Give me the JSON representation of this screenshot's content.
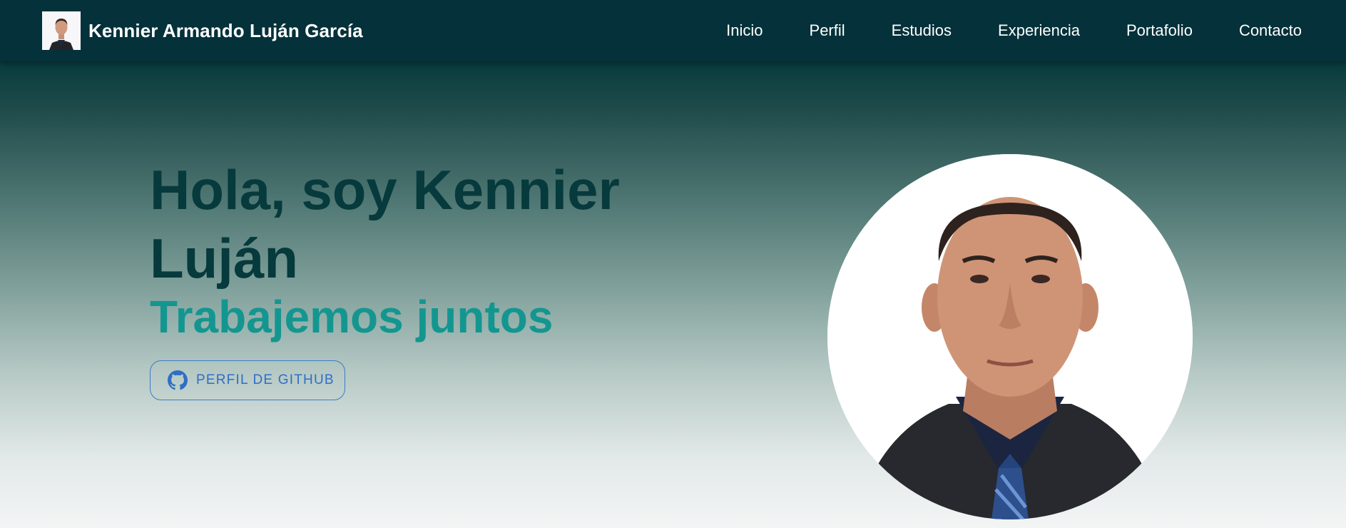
{
  "header": {
    "brand_name": "Kennier Armando Luján García",
    "avatar_icon": "profile-photo-thumbnail",
    "nav_items": [
      {
        "label": "Inicio"
      },
      {
        "label": "Perfil"
      },
      {
        "label": "Estudios"
      },
      {
        "label": "Experiencia"
      },
      {
        "label": "Portafolio"
      },
      {
        "label": "Contacto"
      }
    ]
  },
  "hero": {
    "title": "Hola, soy Kennier Luján",
    "subtitle": "Trabajemos juntos",
    "github_button": {
      "label": "Perfil de GitHub",
      "icon": "github-icon"
    },
    "portrait_icon": "profile-portrait"
  },
  "colors": {
    "navbar": "#04313a",
    "title": "#063a3c",
    "subtitle": "#149690",
    "button": "#2f6ec4"
  }
}
